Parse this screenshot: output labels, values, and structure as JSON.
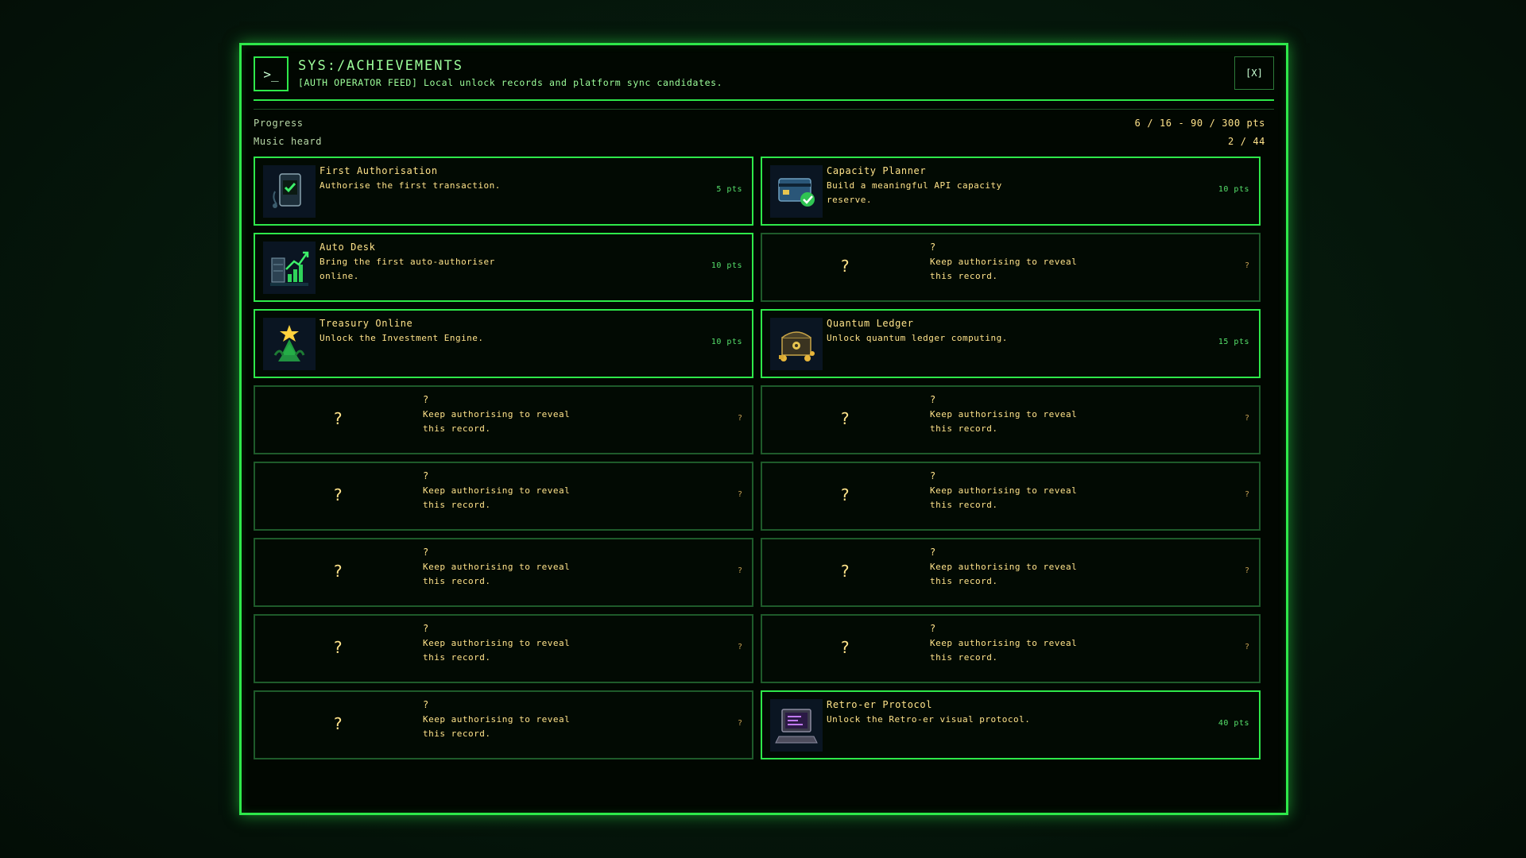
{
  "header": {
    "prompt_symbol": ">_",
    "title": "SYS:/ACHIEVEMENTS",
    "subtitle": "[AUTH OPERATOR FEED] Local unlock records and platform sync candidates.",
    "close_label": "[X]"
  },
  "stats": [
    {
      "label": "Progress",
      "value": "6 / 16 - 90 / 300 pts"
    },
    {
      "label": "Music heard",
      "value": "2 / 44"
    }
  ],
  "achievements": [
    {
      "name": "First Authorisation",
      "desc": "Authorise the first transaction.",
      "pts": "5 pts",
      "icon": "terminal-check-icon"
    },
    {
      "name": "Capacity Planner",
      "desc": "Build a meaningful API capacity reserve.",
      "pts": "10 pts",
      "icon": "card-check-icon"
    },
    {
      "name": "Auto Desk",
      "desc": "Bring the first auto-authoriser online.",
      "pts": "10 pts",
      "icon": "server-chart-icon"
    },
    {
      "locked": true,
      "q": "?",
      "name": "?",
      "desc": "Keep authorising to reveal this record.",
      "pts": "?"
    },
    {
      "name": "Treasury Online",
      "desc": "Unlock the Investment Engine.",
      "pts": "10 pts",
      "icon": "star-tree-icon"
    },
    {
      "name": "Quantum Ledger",
      "desc": "Unlock quantum ledger computing.",
      "pts": "15 pts",
      "icon": "treasure-chest-icon"
    },
    {
      "locked": true,
      "q": "?",
      "name": "?",
      "desc": "Keep authorising to reveal this record.",
      "pts": "?"
    },
    {
      "locked": true,
      "q": "?",
      "name": "?",
      "desc": "Keep authorising to reveal this record.",
      "pts": "?"
    },
    {
      "locked": true,
      "q": "?",
      "name": "?",
      "desc": "Keep authorising to reveal this record.",
      "pts": "?"
    },
    {
      "locked": true,
      "q": "?",
      "name": "?",
      "desc": "Keep authorising to reveal this record.",
      "pts": "?"
    },
    {
      "locked": true,
      "q": "?",
      "name": "?",
      "desc": "Keep authorising to reveal this record.",
      "pts": "?"
    },
    {
      "locked": true,
      "q": "?",
      "name": "?",
      "desc": "Keep authorising to reveal this record.",
      "pts": "?"
    },
    {
      "locked": true,
      "q": "?",
      "name": "?",
      "desc": "Keep authorising to reveal this record.",
      "pts": "?"
    },
    {
      "locked": true,
      "q": "?",
      "name": "?",
      "desc": "Keep authorising to reveal this record.",
      "pts": "?"
    },
    {
      "locked": true,
      "q": "?",
      "name": "?",
      "desc": "Keep authorising to reveal this record.",
      "pts": "?"
    },
    {
      "name": "Retro-er Protocol",
      "desc": "Unlock the Retro-er visual protocol.",
      "pts": "40 pts",
      "icon": "retro-computer-icon"
    }
  ],
  "colors": {
    "accent": "#2ee84a",
    "text_yellow": "#ffe38a",
    "pts_green": "#56e06b"
  }
}
